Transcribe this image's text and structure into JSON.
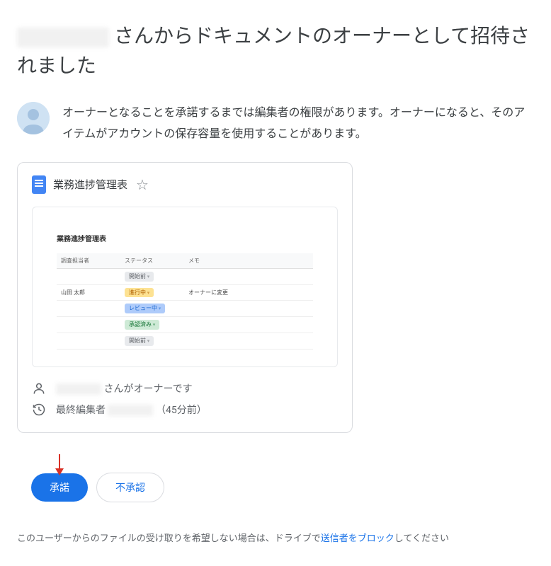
{
  "title": {
    "suffix": "さんからドキュメントのオーナーとして招待されました"
  },
  "notice": {
    "text": "オーナーとなることを承諾するまでは編集者の権限があります。オーナーになると、そのアイテムがアカウントの保存容量を使用することがあります。"
  },
  "doc": {
    "title": "業務進捗管理表",
    "thumbnail": {
      "title": "業務進捗管理表",
      "headers": [
        "調査担当者",
        "ステータス",
        "メモ"
      ],
      "rows": [
        {
          "person": "",
          "status": "開始前",
          "status_color": "gray",
          "memo": ""
        },
        {
          "person": "山田 太郎",
          "status": "進行中",
          "status_color": "orange",
          "memo": "オーナーに変更"
        },
        {
          "person": "",
          "status": "レビュー中",
          "status_color": "blue",
          "memo": ""
        },
        {
          "person": "",
          "status": "承認済み",
          "status_color": "green",
          "memo": ""
        },
        {
          "person": "",
          "status": "開始前",
          "status_color": "gray",
          "memo": ""
        }
      ]
    },
    "owner_suffix": "さんがオーナーです",
    "last_editor_label": "最終編集者",
    "last_editor_time": "（45分前）"
  },
  "buttons": {
    "accept": "承諾",
    "decline": "不承認"
  },
  "footer": {
    "prefix": "このユーザーからのファイルの受け取りを希望しない場合は、ドライブで",
    "link": "送信者をブロック",
    "suffix": "してください"
  }
}
